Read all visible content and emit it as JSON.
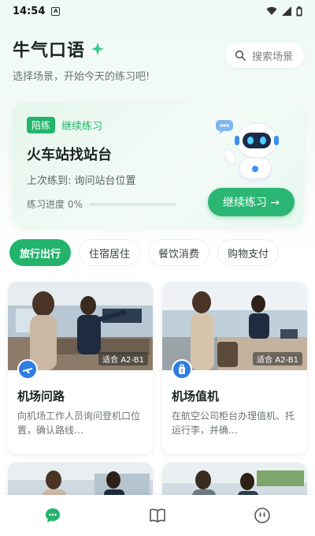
{
  "status_bar": {
    "time": "14:54",
    "notif_icon": "notification-a-icon",
    "wifi_icon": "wifi-icon",
    "signal_icon": "signal-icon",
    "battery_icon": "battery-icon"
  },
  "header": {
    "title": "牛气口语",
    "subtitle": "选择场景，开始今天的练习吧!",
    "search_placeholder": "搜索场景"
  },
  "continue_card": {
    "tag": "陪练",
    "tag_text": "继续练习",
    "title": "火车站找站台",
    "last_practice": "上次练到: 询问站台位置",
    "progress_label": "练习进度 0%",
    "progress_value": 0,
    "button_label": "继续练习 →"
  },
  "tabs": [
    "旅行出行",
    "住宿居住",
    "餐饮消费",
    "购物支付"
  ],
  "active_tab": 0,
  "scenarios": [
    {
      "title": "机场问路",
      "desc": "向机场工作人员询问登机口位置，确认路线…",
      "sign": "适合 A2-B1",
      "icon": "airplane-icon"
    },
    {
      "title": "机场值机",
      "desc": "在航空公司柜台办理值机、托运行李，并确…",
      "sign": "适合 A2-B1",
      "icon": "luggage-icon"
    }
  ],
  "bottom_nav": [
    "chat-icon",
    "book-icon",
    "profile-icon"
  ],
  "colors": {
    "accent": "#22b46b",
    "badge_blue": "#2f7de1"
  }
}
